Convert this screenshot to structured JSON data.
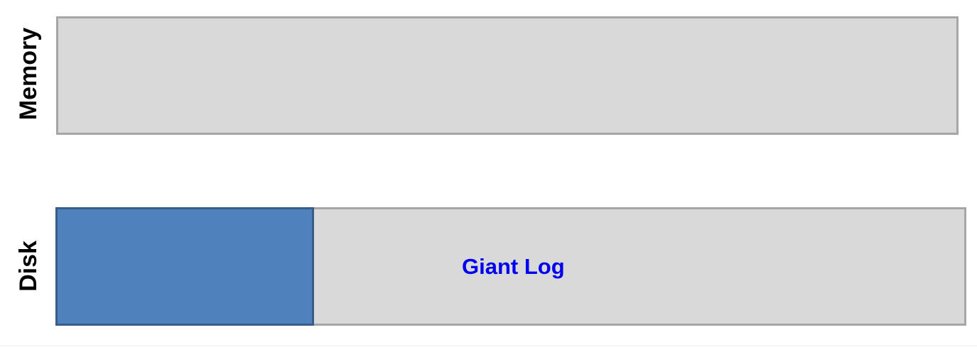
{
  "labels": {
    "memory": "Memory",
    "disk": "Disk"
  },
  "disk": {
    "log_label": "Giant Log"
  },
  "colors": {
    "box_fill": "#d9d9d9",
    "box_border": "#a6a6a6",
    "used_block_fill": "#4f81bd",
    "used_block_border": "#385d8a",
    "log_text": "#0000ee"
  }
}
